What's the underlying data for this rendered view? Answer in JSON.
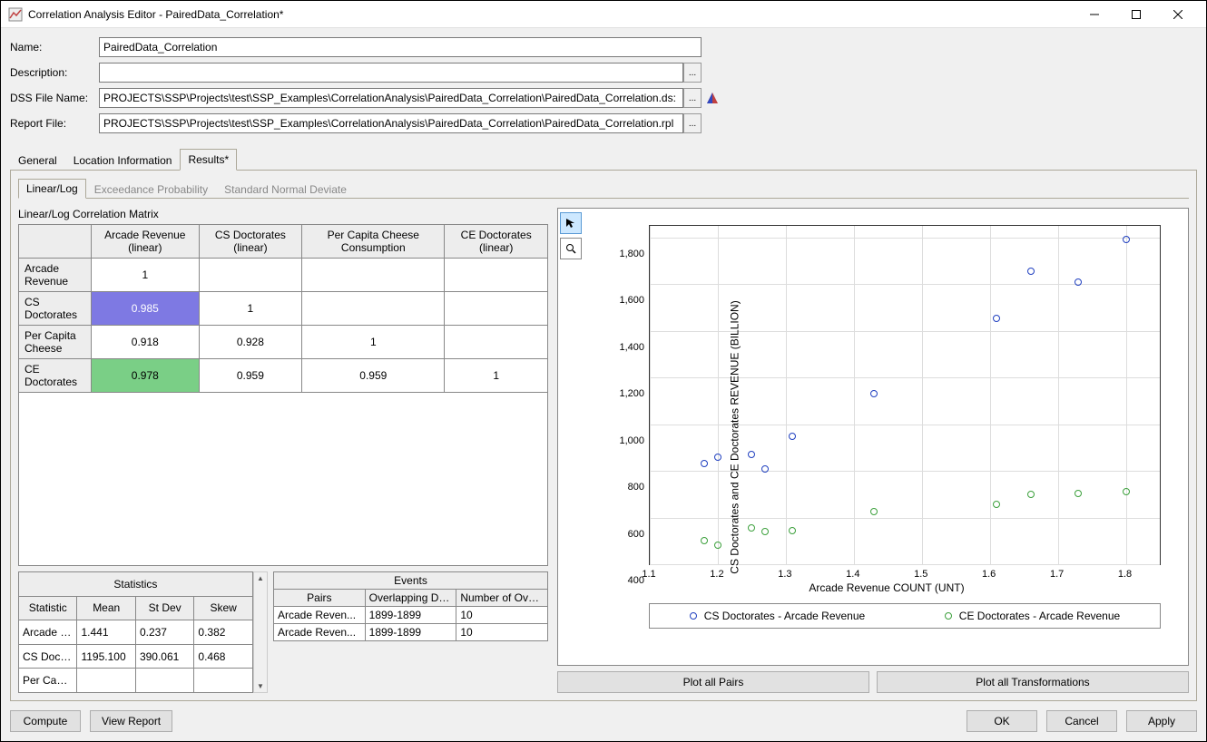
{
  "window": {
    "title": "Correlation Analysis Editor - PairedData_Correlation*"
  },
  "form": {
    "name_label": "Name:",
    "name_value": "PairedData_Correlation",
    "desc_label": "Description:",
    "desc_value": "",
    "dss_label": "DSS File Name:",
    "dss_value": "PROJECTS\\SSP\\Projects\\test\\SSP_Examples\\CorrelationAnalysis\\PairedData_Correlation\\PairedData_Correlation.ds:",
    "report_label": "Report File:",
    "report_value": "PROJECTS\\SSP\\Projects\\test\\SSP_Examples\\CorrelationAnalysis\\PairedData_Correlation\\PairedData_Correlation.rpl",
    "ellipsis": "..."
  },
  "tabs": {
    "general": "General",
    "location": "Location Information",
    "results": "Results*"
  },
  "subtabs": {
    "linlog": "Linear/Log",
    "exceed": "Exceedance Probability",
    "snd": "Standard Normal Deviate"
  },
  "matrix": {
    "title": "Linear/Log Correlation Matrix",
    "cols": [
      "Arcade Revenue (linear)",
      "CS Doctorates (linear)",
      "Per Capita Cheese Consumption",
      "CE Doctorates (linear)"
    ],
    "rows": [
      "Arcade Revenue",
      "CS Doctorates",
      "Per Capita Cheese",
      "CE Doctorates"
    ],
    "cells": [
      [
        "1",
        "",
        "",
        ""
      ],
      [
        "0.985",
        "1",
        "",
        ""
      ],
      [
        "0.918",
        "0.928",
        "1",
        ""
      ],
      [
        "0.978",
        "0.959",
        "0.959",
        "1"
      ]
    ]
  },
  "stats": {
    "title": "Statistics",
    "cols": [
      "Statistic",
      "Mean",
      "St Dev",
      "Skew"
    ],
    "rows": [
      [
        "Arcade Revenue",
        "1.441",
        "0.237",
        "0.382"
      ],
      [
        "CS Doctorates",
        "1195.100",
        "390.061",
        "0.468"
      ],
      [
        "Per Capita",
        "",
        "",
        ""
      ]
    ]
  },
  "events": {
    "title": "Events",
    "cols": [
      "Pairs",
      "Overlapping Date Range",
      "Number of Overlapping Values"
    ],
    "rows": [
      [
        "Arcade Reven...",
        "1899-1899",
        "10"
      ],
      [
        "Arcade Reven...",
        "1899-1899",
        "10"
      ]
    ]
  },
  "chart_data": {
    "type": "scatter",
    "xlabel": "Arcade Revenue COUNT (UNT)",
    "ylabel": "CS Doctorates and CE Doctorates REVENUE (BILLION)",
    "xlim": [
      1.1,
      1.85
    ],
    "ylim": [
      400,
      1850
    ],
    "xticks": [
      1.1,
      1.2,
      1.3,
      1.4,
      1.5,
      1.6,
      1.7,
      1.8
    ],
    "yticks": [
      400,
      600,
      800,
      1000,
      1200,
      1400,
      1600,
      1800
    ],
    "series": [
      {
        "name": "CS Doctorates - Arcade Revenue",
        "color": "#2040c0",
        "points": [
          {
            "x": 1.18,
            "y": 830
          },
          {
            "x": 1.2,
            "y": 860
          },
          {
            "x": 1.25,
            "y": 870
          },
          {
            "x": 1.27,
            "y": 810
          },
          {
            "x": 1.31,
            "y": 950
          },
          {
            "x": 1.43,
            "y": 1130
          },
          {
            "x": 1.61,
            "y": 1455
          },
          {
            "x": 1.66,
            "y": 1655
          },
          {
            "x": 1.73,
            "y": 1610
          },
          {
            "x": 1.8,
            "y": 1790
          }
        ]
      },
      {
        "name": "CE Doctorates - Arcade Revenue",
        "color": "#3ca03c",
        "points": [
          {
            "x": 1.18,
            "y": 500
          },
          {
            "x": 1.2,
            "y": 480
          },
          {
            "x": 1.25,
            "y": 555
          },
          {
            "x": 1.27,
            "y": 540
          },
          {
            "x": 1.31,
            "y": 545
          },
          {
            "x": 1.43,
            "y": 625
          },
          {
            "x": 1.61,
            "y": 655
          },
          {
            "x": 1.66,
            "y": 700
          },
          {
            "x": 1.73,
            "y": 705
          },
          {
            "x": 1.8,
            "y": 710
          }
        ]
      }
    ]
  },
  "buttons": {
    "plot_pairs": "Plot all Pairs",
    "plot_trans": "Plot all Transformations",
    "compute": "Compute",
    "view_report": "View Report",
    "ok": "OK",
    "cancel": "Cancel",
    "apply": "Apply"
  }
}
